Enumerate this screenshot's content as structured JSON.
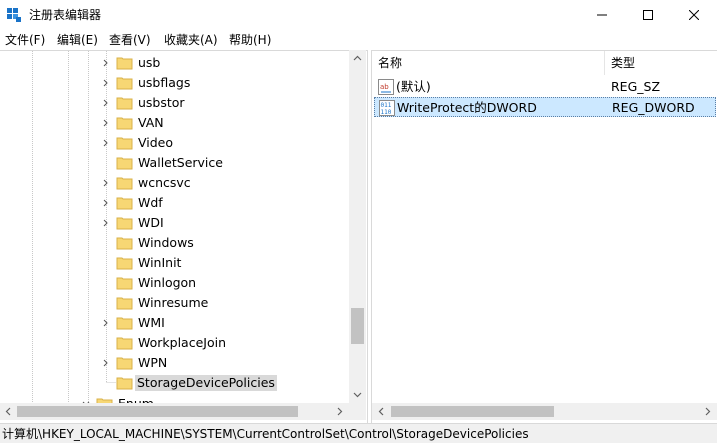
{
  "window": {
    "title": "注册表编辑器"
  },
  "menu": {
    "items": [
      "文件(F)",
      "编辑(E)",
      "查看(V)",
      "收藏夹(A)",
      "帮助(H)"
    ]
  },
  "tree": {
    "items": [
      {
        "label": "usb",
        "expandable": true
      },
      {
        "label": "usbflags",
        "expandable": true
      },
      {
        "label": "usbstor",
        "expandable": true
      },
      {
        "label": "VAN",
        "expandable": true
      },
      {
        "label": "Video",
        "expandable": true
      },
      {
        "label": "WalletService",
        "expandable": false
      },
      {
        "label": "wcncsvc",
        "expandable": true
      },
      {
        "label": "Wdf",
        "expandable": true
      },
      {
        "label": "WDI",
        "expandable": true
      },
      {
        "label": "Windows",
        "expandable": false
      },
      {
        "label": "WinInit",
        "expandable": false
      },
      {
        "label": "Winlogon",
        "expandable": false
      },
      {
        "label": "Winresume",
        "expandable": false
      },
      {
        "label": "WMI",
        "expandable": true
      },
      {
        "label": "WorkplaceJoin",
        "expandable": false
      },
      {
        "label": "WPN",
        "expandable": true
      },
      {
        "label": "StorageDevicePolicies",
        "expandable": false,
        "selected": true
      }
    ],
    "partial_item": "Enum"
  },
  "list": {
    "columns": {
      "name": "名称",
      "type": "类型"
    },
    "rows": [
      {
        "name": "(默认)",
        "type": "REG_SZ",
        "icon": "string-value-icon"
      },
      {
        "name": "WriteProtect的DWORD",
        "type": "REG_DWORD",
        "icon": "binary-value-icon",
        "selected": true
      }
    ]
  },
  "status": {
    "path": "计算机\\HKEY_LOCAL_MACHINE\\SYSTEM\\CurrentControlSet\\Control\\StorageDevicePolicies"
  },
  "colors": {
    "folder": "#f7d774",
    "folder_edge": "#d8b14a",
    "selection": "#cce8ff",
    "tree_selection": "#d9d9d9",
    "app_icon": "#1a73c8"
  }
}
